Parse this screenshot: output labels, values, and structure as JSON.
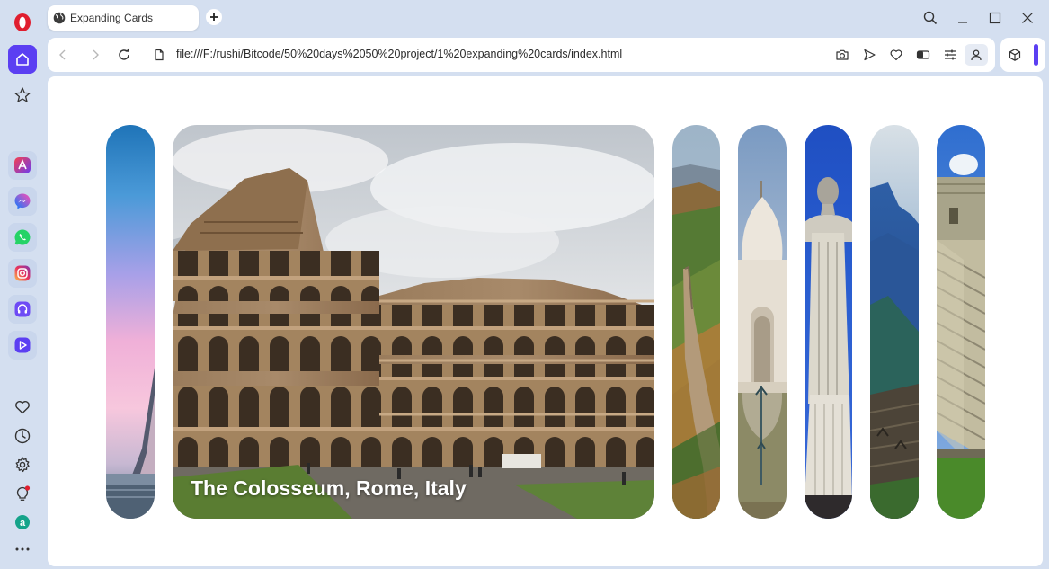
{
  "browser": {
    "tab_title": "Expanding Cards",
    "url": "file:///F:/rushi/Bitcode/50%20days%2050%20project/1%20expanding%20cards/index.html"
  },
  "sidebar": {
    "top": [
      "opera-logo",
      "home-icon",
      "star-icon"
    ],
    "apps": [
      "aria-icon",
      "messenger-icon",
      "whatsapp-icon",
      "instagram-icon",
      "music-icon",
      "player-icon"
    ],
    "bottom": [
      "heart-icon",
      "history-icon",
      "settings-icon",
      "bulb-icon",
      "app-a-icon",
      "more-icon"
    ]
  },
  "page": {
    "cards": [
      {
        "id": "eiffel",
        "active": false
      },
      {
        "id": "colosseum",
        "active": true,
        "title": "The Colosseum, Rome, Italy"
      },
      {
        "id": "great-wall",
        "active": false
      },
      {
        "id": "taj-mahal",
        "active": false
      },
      {
        "id": "christ-redeemer",
        "active": false
      },
      {
        "id": "machu-picchu",
        "active": false
      },
      {
        "id": "chichen-itza",
        "active": false
      }
    ]
  },
  "colors": {
    "accent": "#5b3ff2",
    "browser_bg": "#d4dff0",
    "opera_red": "#e01e2f"
  }
}
